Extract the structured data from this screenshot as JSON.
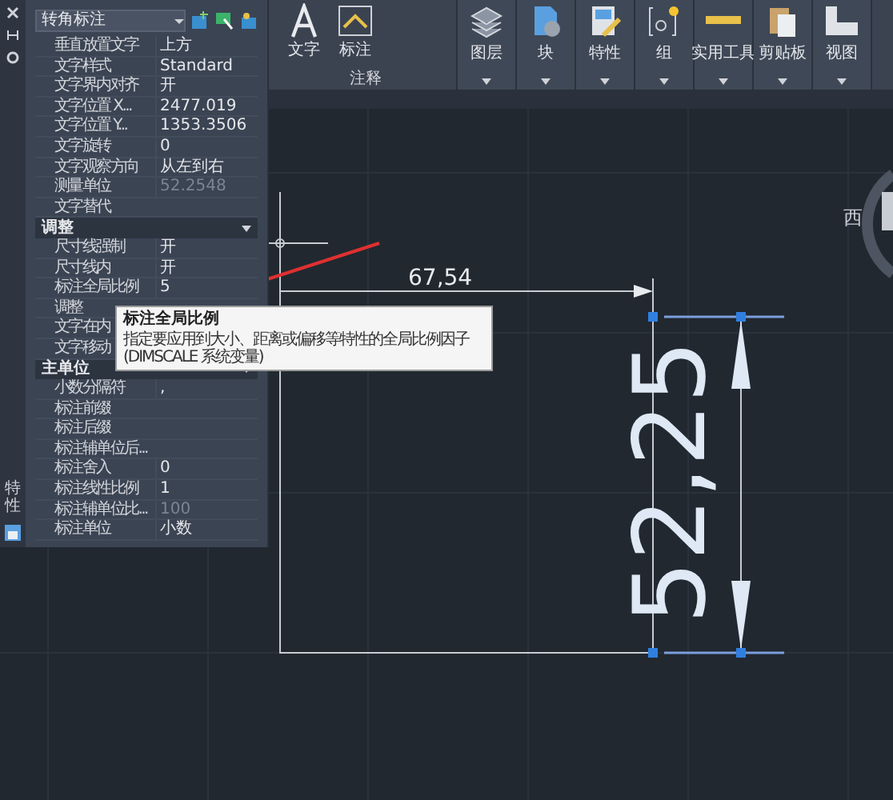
{
  "ribbon": {
    "group_label": "注释",
    "tools": [
      {
        "label": "文字",
        "kind": "text"
      },
      {
        "label": "标注",
        "kind": "dimension"
      }
    ],
    "panels": [
      {
        "label": "图层",
        "kind": "layers"
      },
      {
        "label": "块",
        "kind": "block"
      },
      {
        "label": "特性",
        "kind": "properties"
      },
      {
        "label": "组",
        "kind": "group"
      },
      {
        "label": "实用工具",
        "kind": "utilities"
      },
      {
        "label": "剪贴板",
        "kind": "clipboard"
      },
      {
        "label": "视图",
        "kind": "view"
      }
    ]
  },
  "palette": {
    "side_label": "特性",
    "object_type": "转角标注",
    "sections": [
      {
        "rows": [
          {
            "label": "垂直放置文字",
            "value": "上方",
            "disabled": false
          },
          {
            "label": "文字样式",
            "value": "Standard",
            "disabled": false
          },
          {
            "label": "文字界内对齐",
            "value": "开",
            "disabled": false
          },
          {
            "label": "文字位置 X...",
            "value": "2477.019",
            "disabled": false
          },
          {
            "label": "文字位置 Y...",
            "value": "1353.3506",
            "disabled": false
          },
          {
            "label": "文字旋转",
            "value": "0",
            "disabled": false
          },
          {
            "label": "文字观察方向",
            "value": "从左到右",
            "disabled": false
          },
          {
            "label": "测量单位",
            "value": "52.2548",
            "disabled": true
          },
          {
            "label": "文字替代"
          }
        ]
      },
      {
        "title": "调整",
        "expanded": true,
        "rows": [
          {
            "label": "尺寸线强制",
            "value": "开",
            "disabled": false
          },
          {
            "label": "尺寸线内",
            "value": "开",
            "disabled": false
          },
          {
            "label": "标注全局比例",
            "value": "5",
            "disabled": false
          },
          {
            "label": "调整"
          },
          {
            "label": "文字在内"
          },
          {
            "label": "文字移动"
          }
        ]
      },
      {
        "title": "主单位",
        "expanded": true,
        "rows": [
          {
            "label": "小数分隔符",
            "value": ",",
            "disabled": false
          },
          {
            "label": "标注前缀"
          },
          {
            "label": "标注后缀"
          },
          {
            "label": "标注辅单位后..."
          },
          {
            "label": "标注舍入",
            "value": "0",
            "disabled": false
          },
          {
            "label": "标注线性比例",
            "value": "1",
            "disabled": false
          },
          {
            "label": "标注辅单位比...",
            "value": "100",
            "disabled": true
          },
          {
            "label": "标注单位",
            "value": "小数",
            "disabled": false
          }
        ]
      }
    ]
  },
  "tooltip": {
    "title": "标注全局比例",
    "text": "指定要应用到大小、距离或偏移等特性的全局比例因子 (DIMSCALE 系统变量)"
  },
  "drawing": {
    "horizontal_dimension": "67,54",
    "vertical_dimension": "52,25",
    "viewcube_label": "西"
  }
}
